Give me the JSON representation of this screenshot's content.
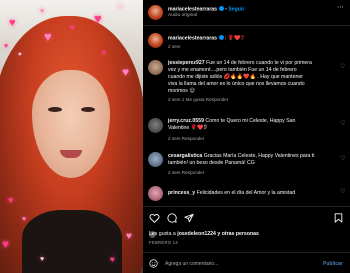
{
  "post": {
    "author": "mariacelestearraras",
    "follow_label": "Seguir",
    "audio": "Audio original",
    "bullet": "•"
  },
  "caption": {
    "username": "mariacelestearraras",
    "text": "I 🌹❤️🤋",
    "time": "2 sem"
  },
  "comments": [
    {
      "username": "jessieperez927",
      "lines": [
        "Fue un 14 de febrero cuando te vi por primera",
        "vez y me enamoré....pero también Fue un 14 de febrero",
        "cuando me dijiste adiós 💋🔥🔥❤️🔥 . Hay que mantener",
        "viva la llama del amor es lo único que nos llevamos cuando",
        "morimos 😊"
      ],
      "meta": "2 sem   1 Me gusta   Responder"
    },
    {
      "username": "jerry.cruz.0559",
      "lines": [
        "Como te Quero mi Celeste, Happy San",
        "Valentine 🌹❤️🤋"
      ],
      "meta": "2 sem   Responder"
    },
    {
      "username": "cesargalistica",
      "lines": [
        "Gracias María Celeste, Happy Valentines para ti",
        "también! un beso desde Panamá! CG"
      ],
      "meta": "2 sem   Responder"
    },
    {
      "username": "princess_y",
      "lines": [
        "Felicidades en el día del Amor y la amistad"
      ],
      "meta": ""
    }
  ],
  "likes": {
    "prefix": "Les gusta a",
    "user": "josedeleon1224",
    "suffix": "y otras personas",
    "date": "FEBRERO 14"
  },
  "comment_box": {
    "placeholder": "Agrega un comentario...",
    "publish_label": "Publicar"
  },
  "icons": {
    "like": "heart-outline-icon",
    "comment": "comment-bubble-icon",
    "share": "paper-plane-icon",
    "save": "bookmark-icon",
    "emoji": "smiley-icon"
  },
  "colors": {
    "accent": "#0095f6",
    "background": "#000000",
    "text": "#f5f5f5",
    "muted": "#a8a8a8"
  }
}
